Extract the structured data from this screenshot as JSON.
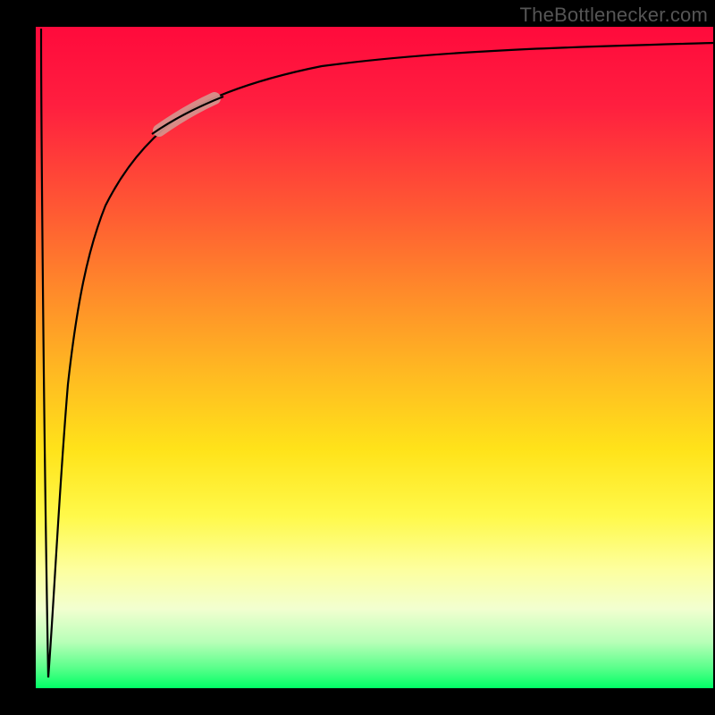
{
  "attribution": "TheBottlenecker.com",
  "colors": {
    "frame": "#000000",
    "curve": "#000000",
    "highlight": "#d6948d",
    "gradient_top": "#ff0a3c",
    "gradient_bottom": "#00ff66"
  },
  "chart_data": {
    "type": "line",
    "title": "",
    "xlabel": "",
    "ylabel": "",
    "xlim": [
      0,
      100
    ],
    "ylim": [
      0,
      100
    ],
    "grid": false,
    "legend": false,
    "annotations": [
      "TheBottlenecker.com"
    ],
    "description": "Bottleneck-style curve: sharp vertical drop near x≈0 (from y≈100 to y≈0), then quasi-log rise toward an asymptote near y≈96 as x→100. A highlighted pill-shaped segment sits on the rising curve around x≈17–25, y≈83–87.",
    "series": [
      {
        "name": "bottleneck-curve",
        "x": [
          0,
          1,
          1.5,
          2,
          3,
          4,
          6,
          8,
          10,
          12,
          15,
          18,
          22,
          26,
          30,
          35,
          40,
          50,
          60,
          70,
          80,
          90,
          100
        ],
        "values": [
          100,
          15,
          3,
          30,
          50,
          60,
          68,
          73,
          77,
          80,
          82,
          84,
          86,
          87,
          88.5,
          89.5,
          90.5,
          92,
          93,
          93.8,
          94.4,
          95,
          95.5
        ]
      }
    ],
    "highlight_segment": {
      "x_start": 17,
      "x_end": 25,
      "y_start": 83,
      "y_end": 87
    }
  }
}
